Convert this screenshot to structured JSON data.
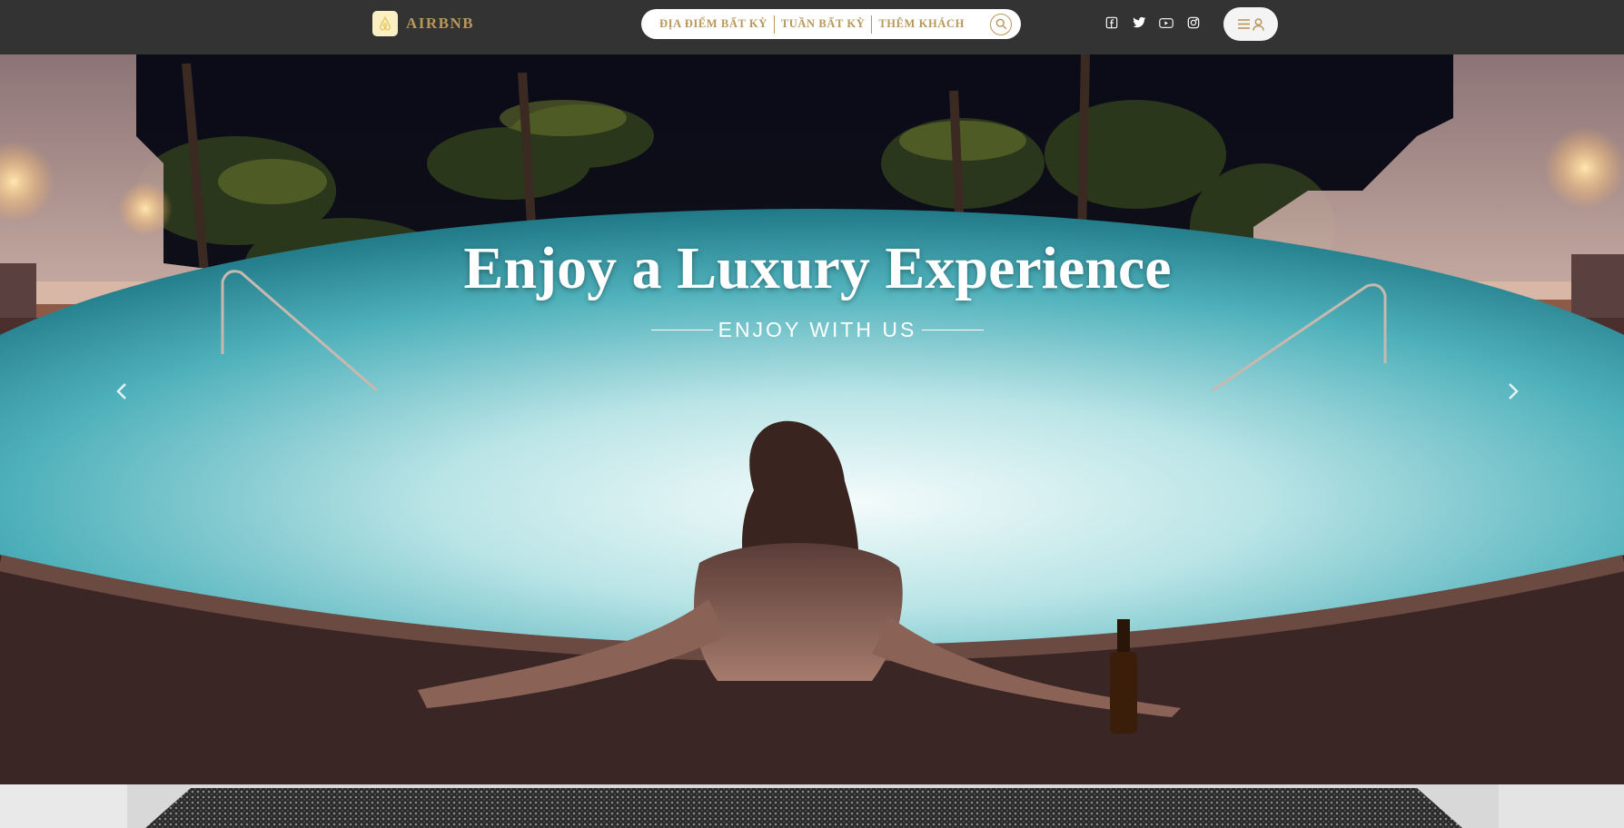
{
  "brand": {
    "name": "AIRBNB",
    "logo_icon": "airbnb-logo-icon"
  },
  "search": {
    "segments": [
      "ĐỊA ĐIỂM BẤT KỲ",
      "TUẦN BẤT KỲ",
      "THÊM KHÁCH"
    ],
    "button_icon": "search-icon"
  },
  "socials": [
    {
      "name": "facebook",
      "icon": "facebook-icon"
    },
    {
      "name": "twitter",
      "icon": "twitter-icon"
    },
    {
      "name": "youtube",
      "icon": "youtube-icon"
    },
    {
      "name": "instagram",
      "icon": "instagram-icon"
    }
  ],
  "user_menu": {
    "icons": [
      "menu-icon",
      "user-icon"
    ]
  },
  "hero": {
    "title": "Enjoy a Luxury Experience",
    "subtitle": "ENJOY WITH US",
    "prev_icon": "chevron-left-icon",
    "next_icon": "chevron-right-icon"
  },
  "colors": {
    "nav_bg": "#333333",
    "accent_gold": "#b8975a",
    "logo_bg": "#fbefc4",
    "text_light": "#ffffff"
  }
}
